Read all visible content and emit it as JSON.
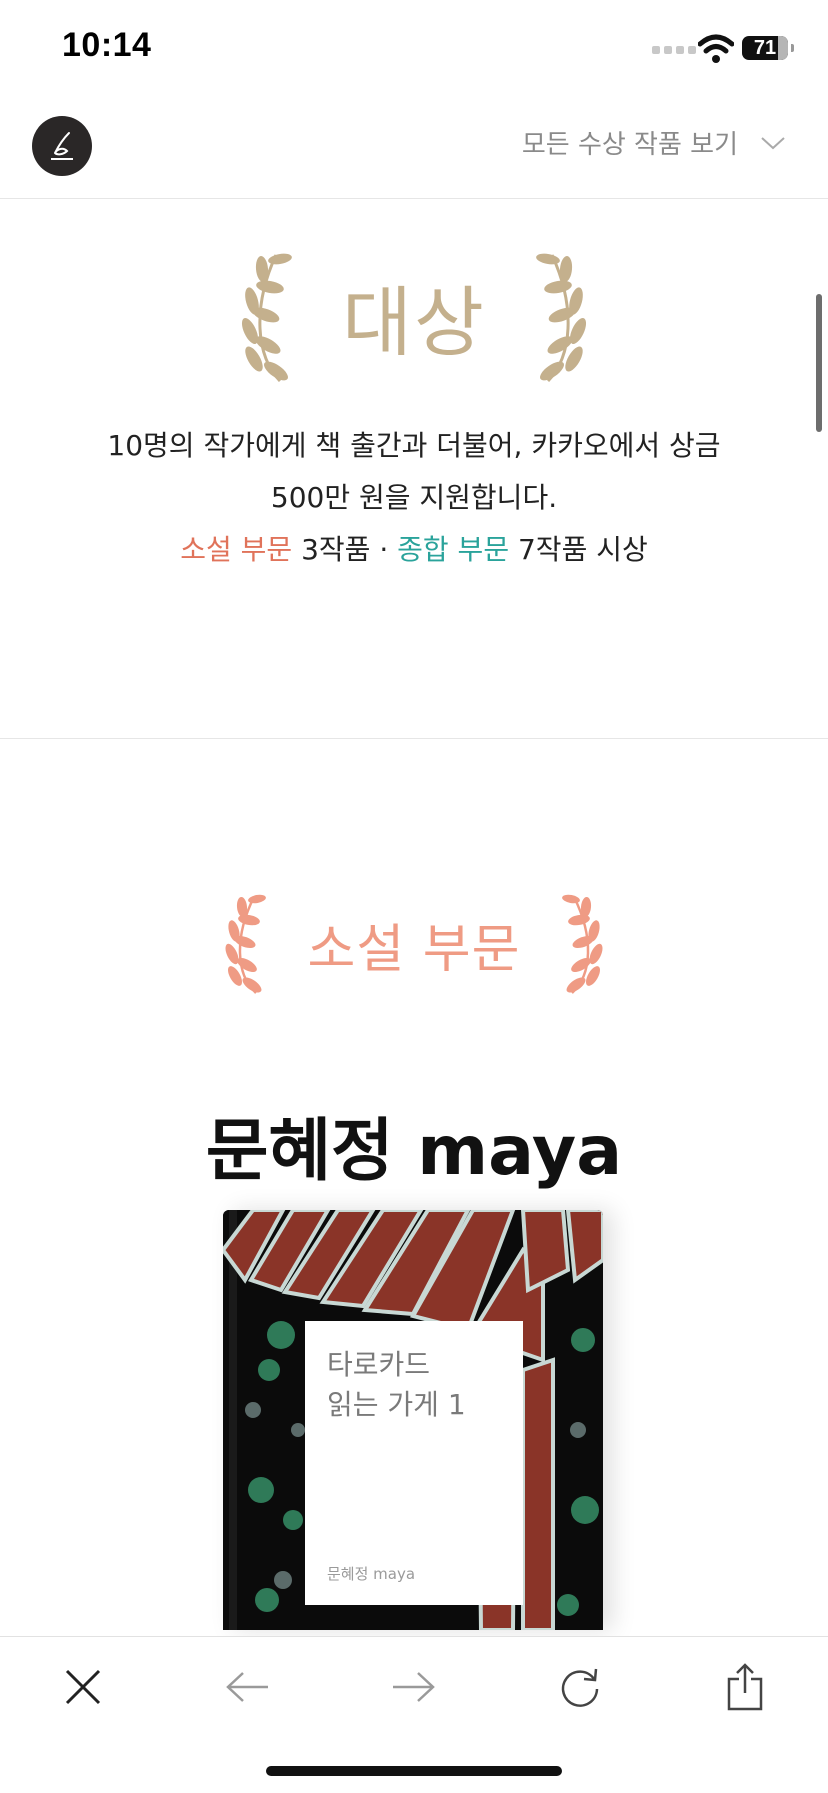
{
  "status": {
    "time": "10:14",
    "battery": "71"
  },
  "header": {
    "award_select_label": "모든 수상 작품 보기"
  },
  "grand": {
    "title": "대상",
    "desc_line1": "10명의 작가에게 책 출간과 더불어, 카카오에서 상금",
    "desc_line2": "500만 원을 지원합니다.",
    "novel_label": "소설 부문",
    "novel_count": " 3작품",
    "separator": " · ",
    "general_label": "종합 부문",
    "general_count": " 7작품 시상"
  },
  "novel": {
    "title": "소설 부문",
    "author": "문혜정 maya",
    "book_title_line1": "타로카드",
    "book_title_line2": "읽는 가게 1",
    "book_author": "문혜정 maya"
  },
  "colors": {
    "gold": "#c4b08d",
    "novel_accent": "#e0735a",
    "novel_title": "#ef9b84",
    "general_accent": "#2aa39b"
  },
  "icons": [
    "close-icon",
    "back-icon",
    "forward-icon",
    "reload-icon",
    "share-icon",
    "chevron-down-icon",
    "pen-logo-icon",
    "laurel-icon"
  ]
}
